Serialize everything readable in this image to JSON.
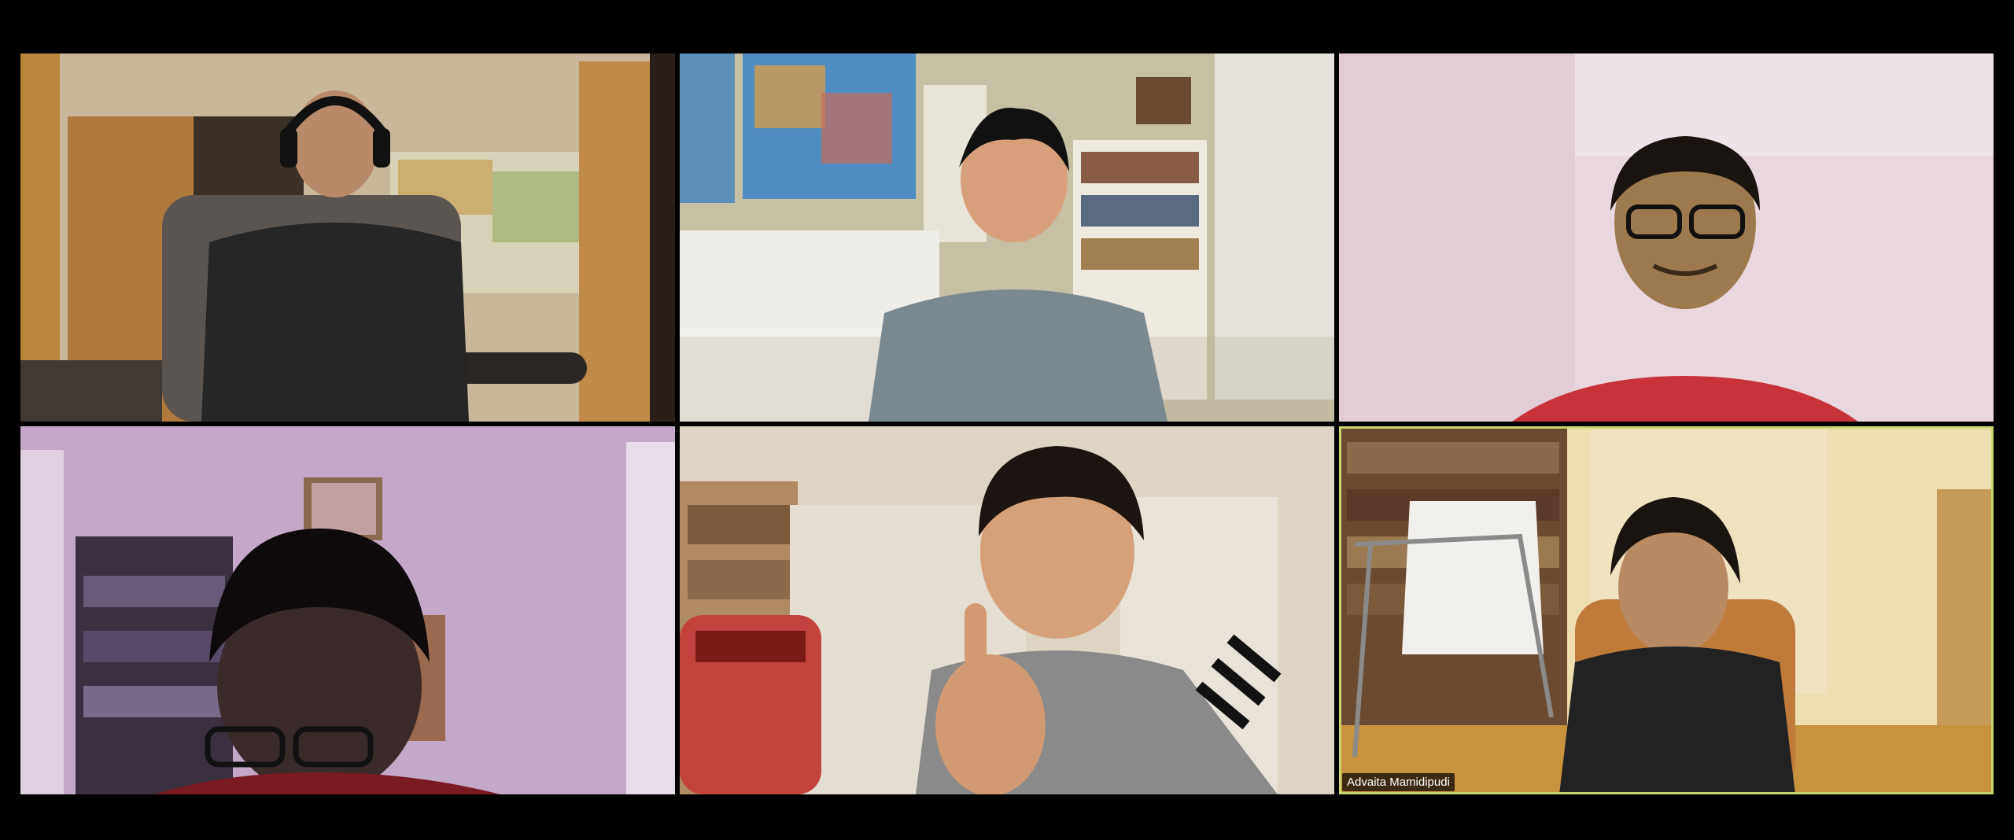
{
  "gallery": {
    "active_speaker_name": "Advaita Mamidipudi",
    "active_color": "#c9d86a"
  }
}
